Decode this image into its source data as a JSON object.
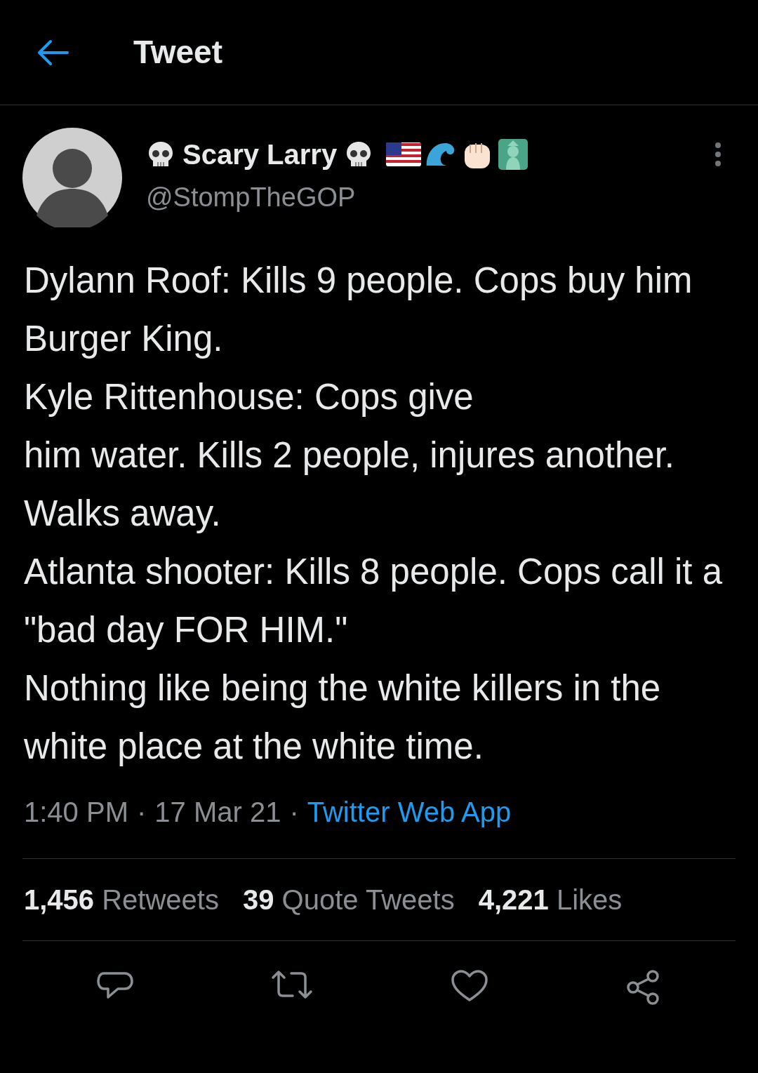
{
  "header": {
    "title": "Tweet"
  },
  "author": {
    "name": "Scary Larry",
    "handle": "@StompTheGOP"
  },
  "tweet": {
    "text": "Dylann Roof: Kills 9 people. Cops buy him Burger King.\nKyle Rittenhouse: Cops give\nhim water. Kills 2 people, injures another. Walks away.\nAtlanta shooter: Kills 8 people. Cops call it a \"bad day FOR HIM.\"\nNothing like being the white killers in the white place at the white time."
  },
  "meta": {
    "time": "1:40 PM",
    "separator_1": "·",
    "date": "17 Mar 21",
    "separator_2": "·",
    "source": "Twitter Web App"
  },
  "stats": [
    {
      "count": "1,456",
      "label": "Retweets"
    },
    {
      "count": "39",
      "label": "Quote Tweets"
    },
    {
      "count": "4,221",
      "label": "Likes"
    }
  ]
}
